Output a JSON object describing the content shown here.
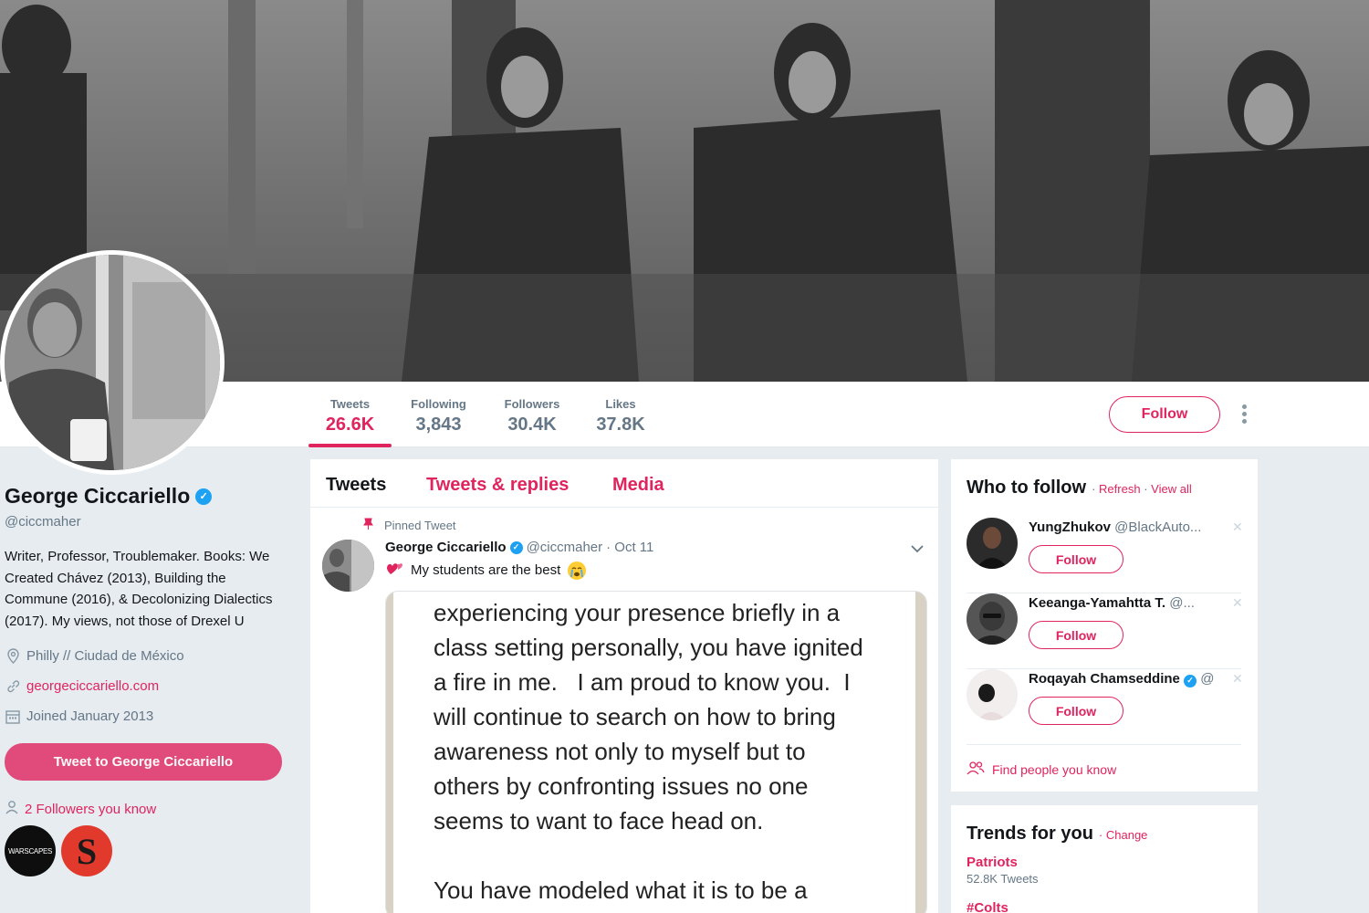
{
  "profile": {
    "name": "George Ciccariello",
    "handle": "@ciccmaher",
    "bio": "Writer, Professor, Troublemaker. Books: We Created Chávez (2013), Building the Commune (2016), & Decolonizing Dialectics (2017). My views, not those of Drexel U",
    "location": "Philly // Ciudad de México",
    "website": "georgeciccariello.com",
    "joined": "Joined January 2013",
    "tweet_to_label": "Tweet to George Ciccariello",
    "followers_you_know": "2 Followers you know",
    "known_followers": [
      {
        "label": "WARSCAPES"
      },
      {
        "label": "S"
      }
    ]
  },
  "stats": [
    {
      "label": "Tweets",
      "value": "26.6K"
    },
    {
      "label": "Following",
      "value": "3,843"
    },
    {
      "label": "Followers",
      "value": "30.4K"
    },
    {
      "label": "Likes",
      "value": "37.8K"
    }
  ],
  "header": {
    "follow_label": "Follow"
  },
  "timeline": {
    "tabs": [
      "Tweets",
      "Tweets & replies",
      "Media"
    ],
    "pinned_label": "Pinned Tweet",
    "tweet": {
      "author": "George Ciccariello",
      "handle": "@ciccmaher",
      "date": "· Oct 11",
      "text": "My students are the best",
      "image_text": "experiencing your presence briefly in a\nclass setting personally, you have ignited\na fire in me.   I am proud to know you.  I\nwill continue to search on how to bring\nawareness not only to myself but to\nothers by confronting issues no one\nseems to want to face head on.\n\nYou have modeled what it is to be a"
    }
  },
  "who_to_follow": {
    "title": "Who to follow",
    "refresh": "Refresh",
    "view_all": "View all",
    "suggestions": [
      {
        "name": "YungZhukov",
        "handle": "@BlackAuto...",
        "follow": "Follow"
      },
      {
        "name": "Keeanga-Yamahtta T.",
        "handle": "@...",
        "follow": "Follow"
      },
      {
        "name": "Roqayah Chamseddine",
        "handle": "@",
        "follow": "Follow"
      }
    ],
    "find_people": "Find people you know"
  },
  "trends": {
    "title": "Trends for you",
    "change": "Change",
    "items": [
      {
        "name": "Patriots",
        "count": "52.8K Tweets"
      },
      {
        "name": "#Colts",
        "count": ""
      }
    ]
  },
  "colors": {
    "accent": "#e0245e",
    "verified": "#1da1f2",
    "background": "#e6ecf0"
  }
}
